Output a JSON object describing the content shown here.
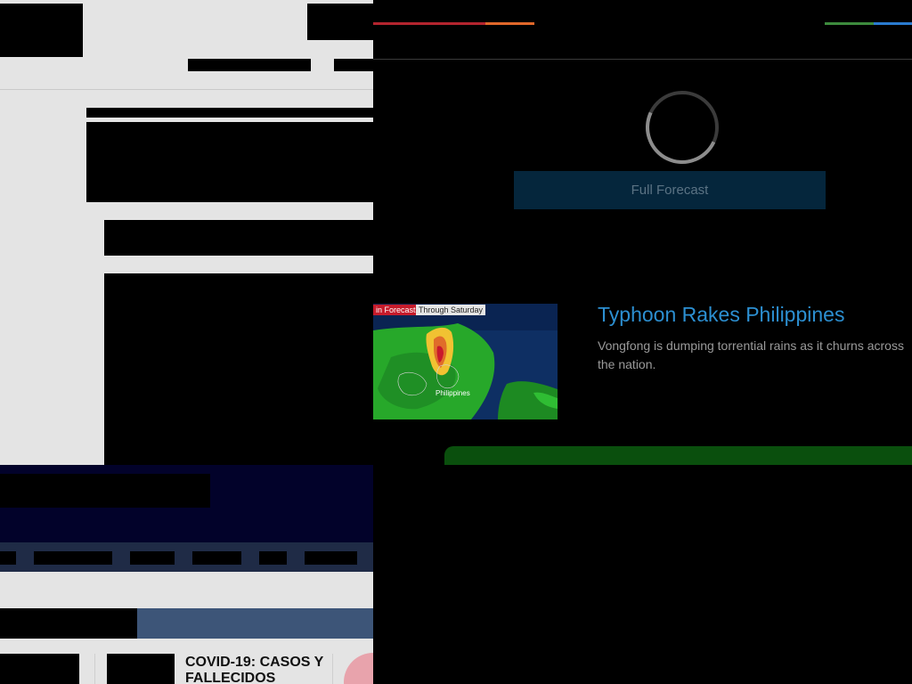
{
  "weather": {
    "forecast_button": "Full Forecast",
    "story": {
      "headline": "Typhoon Rakes Philippines",
      "dek": "Vongfong is dumping torrential rains as it churns across the nation.",
      "image": {
        "tag_red": "in Forecast",
        "tag_white": "Through Saturday",
        "map_label": "Philippines"
      }
    },
    "stripe_colors": [
      "#b3242e",
      "#e0672a",
      "#3d8b3d",
      "#2a7bd0"
    ]
  },
  "news": {
    "card_title": "COVID-19: CASOS Y FALLECIDOS"
  }
}
